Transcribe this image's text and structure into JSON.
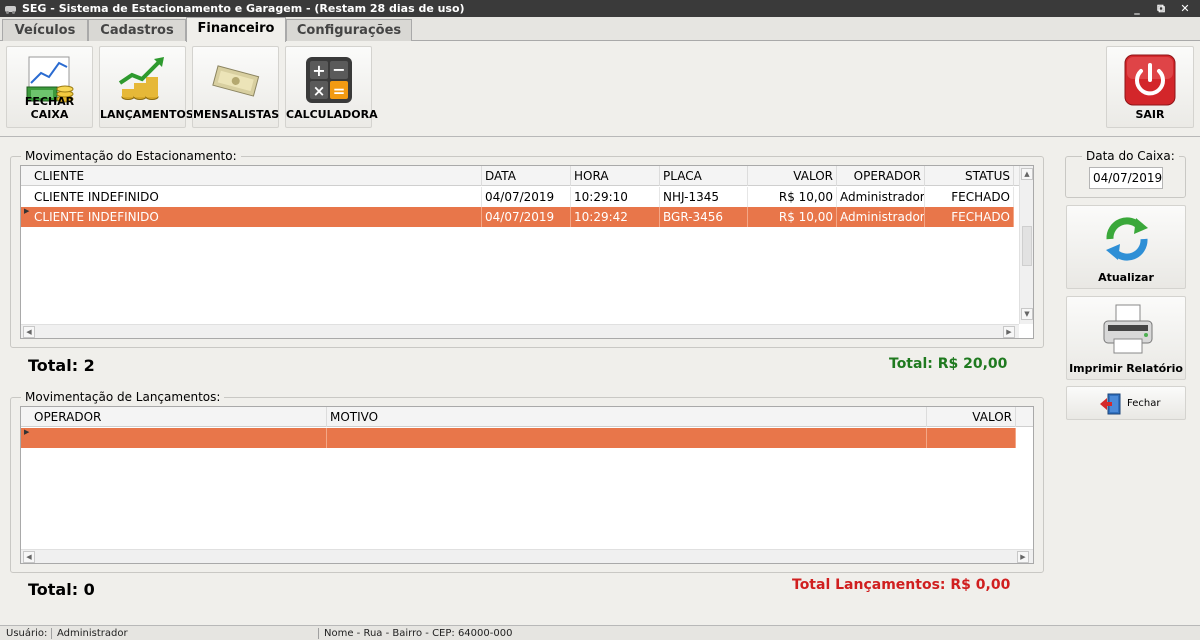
{
  "window": {
    "title": "SEG - Sistema de Estacionamento e Garagem  - (Restam 28 dias de uso)",
    "min_glyph": "_",
    "restore_glyph": "⧉",
    "close_glyph": "✕"
  },
  "tabs": [
    {
      "label": "Veículos"
    },
    {
      "label": "Cadastros"
    },
    {
      "label": "Financeiro"
    },
    {
      "label": "Configurações"
    }
  ],
  "toolbar": {
    "fechar_caixa": "FECHAR CAIXA",
    "lancamentos": "LANÇAMENTOS",
    "mensalistas": "MENSALISTAS",
    "calculadora": "CALCULADORA",
    "sair": "SAIR"
  },
  "estacionamento": {
    "group_title": "Movimentação do Estacionamento:",
    "columns": [
      "CLIENTE",
      "DATA",
      "HORA",
      "PLACA",
      "VALOR",
      "OPERADOR",
      "STATUS"
    ],
    "rows": [
      {
        "cliente": "CLIENTE INDEFINIDO",
        "data": "04/07/2019",
        "hora": "10:29:10",
        "placa": "NHJ-1345",
        "valor": "R$ 10,00",
        "operador": "Administrador",
        "status": "FECHADO"
      },
      {
        "cliente": "CLIENTE INDEFINIDO",
        "data": "04/07/2019",
        "hora": "10:29:42",
        "placa": "BGR-3456",
        "valor": "R$ 10,00",
        "operador": "Administrador",
        "status": "FECHADO"
      }
    ],
    "total_count": "Total: 2",
    "total_value": "Total: R$ 20,00"
  },
  "lancamentos": {
    "group_title": "Movimentação de Lançamentos:",
    "columns": [
      "OPERADOR",
      "MOTIVO",
      "VALOR"
    ],
    "total_count": "Total: 0",
    "total_value": "Total Lançamentos: R$ 0,00"
  },
  "side": {
    "date_label": "Data do Caixa:",
    "date_value": "04/07/2019",
    "atualizar": "Atualizar",
    "imprimir": "Imprimir Relatório",
    "fechar": "Fechar"
  },
  "status_bar": {
    "user_label": "Usuário:",
    "user_value": "Administrador",
    "address": "Nome - Rua - Bairro - CEP: 64000-000"
  },
  "colors": {
    "selection": "#e8764a",
    "total_green": "#1f7a1f",
    "total_red": "#d01f1f"
  },
  "icons": [
    "app-icon",
    "money-chart-icon",
    "growth-coins-icon",
    "cash-bills-icon",
    "calculator-icon",
    "power-icon",
    "refresh-icon",
    "printer-icon",
    "exit-door-icon"
  ]
}
